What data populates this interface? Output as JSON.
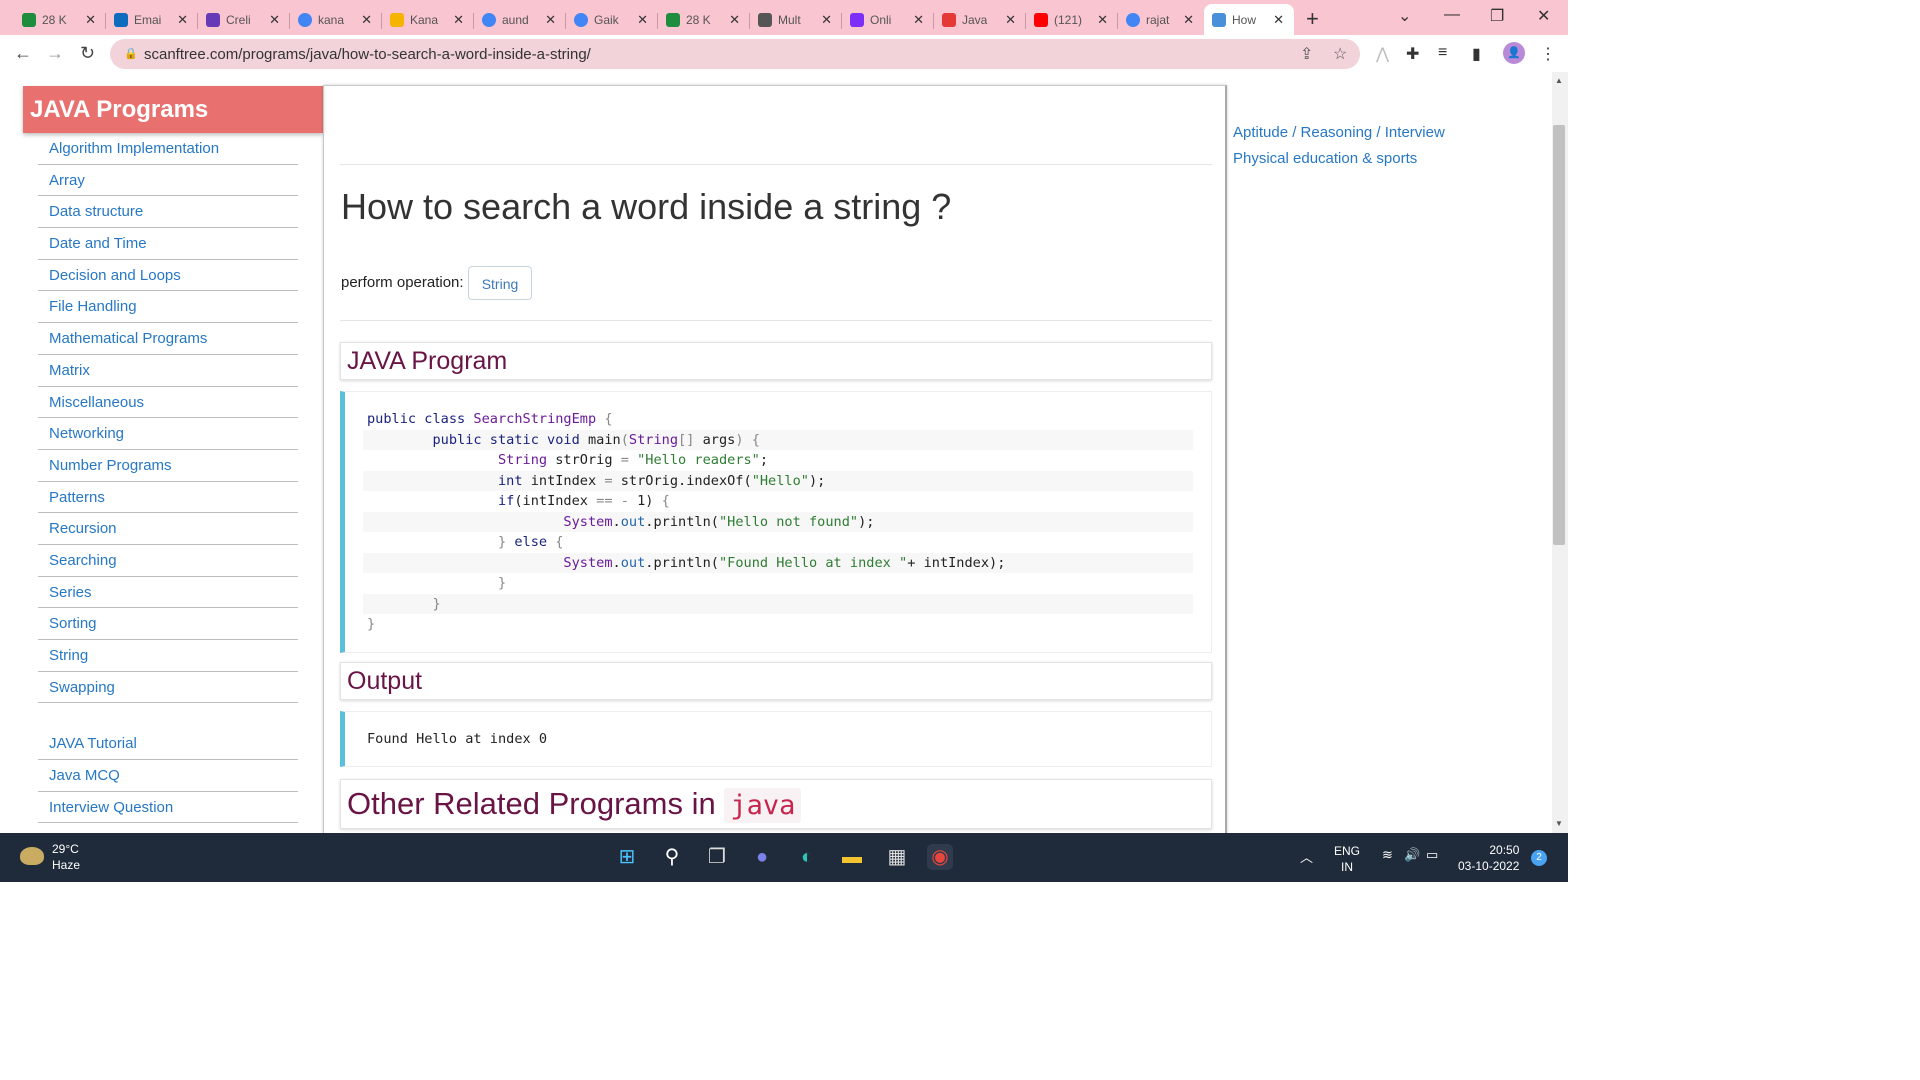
{
  "browser": {
    "tabs": [
      {
        "title": "28 K",
        "icon": "sheets-icon",
        "color": "#1e8e3e"
      },
      {
        "title": "Emai",
        "icon": "outlook-icon",
        "color": "#0f6cbd"
      },
      {
        "title": "Creli",
        "icon": "forms-icon",
        "color": "#673ab7"
      },
      {
        "title": "kana",
        "icon": "google-icon",
        "color": "#4285f4"
      },
      {
        "title": "Kana",
        "icon": "drive-icon",
        "color": "#f4b400"
      },
      {
        "title": "aund",
        "icon": "google-icon",
        "color": "#4285f4"
      },
      {
        "title": "Gaik",
        "icon": "google-icon",
        "color": "#4285f4"
      },
      {
        "title": "28 K",
        "icon": "sheets-icon",
        "color": "#1e8e3e"
      },
      {
        "title": "Mult",
        "icon": "site-icon",
        "color": "#555555"
      },
      {
        "title": "Onli",
        "icon": "p-icon",
        "color": "#7b2ff7"
      },
      {
        "title": "Java",
        "icon": "v-icon",
        "color": "#e53935"
      },
      {
        "title": "(121)",
        "icon": "youtube-icon",
        "color": "#ff0000"
      },
      {
        "title": "rajat",
        "icon": "google-icon",
        "color": "#4285f4"
      },
      {
        "title": "How",
        "icon": "scanftree-icon",
        "color": "#4a90d9",
        "active": true
      }
    ],
    "url": "scanftree.com/programs/java/how-to-search-a-word-inside-a-string/"
  },
  "sidebar": {
    "title": "JAVA Programs",
    "items": [
      "Algorithm Implementation",
      "Array",
      "Data structure",
      "Date and Time",
      "Decision and Loops",
      "File Handling",
      "Mathematical Programs",
      "Matrix",
      "Miscellaneous",
      "Networking",
      "Number Programs",
      "Patterns",
      "Recursion",
      "Searching",
      "Series",
      "Sorting",
      "String",
      "Swapping"
    ],
    "extra_items": [
      "JAVA Tutorial",
      "Java MCQ",
      "Interview Question"
    ]
  },
  "main": {
    "title": "How to search a word inside a string ?",
    "perform_label": "perform operation:",
    "tag_button": "String",
    "program_heading": "JAVA Program",
    "output_heading": "Output",
    "output_text": "Found Hello at index 0",
    "related_heading": "Other Related Programs in",
    "related_code": "java"
  },
  "right_links": [
    "Aptitude / Reasoning / Interview",
    "Physical education & sports"
  ],
  "taskbar": {
    "temperature": "29°C",
    "weather": "Haze",
    "lang_top": "ENG",
    "lang_bottom": "IN",
    "time": "20:50",
    "date": "03-10-2022",
    "notifications": "2"
  },
  "colors": {
    "sidebar_title_bg": "#e8716f",
    "link": "#2778c4",
    "heading": "#6a1446",
    "code_accent": "#5bc0de",
    "browser_frame": "#f9c5d0"
  }
}
